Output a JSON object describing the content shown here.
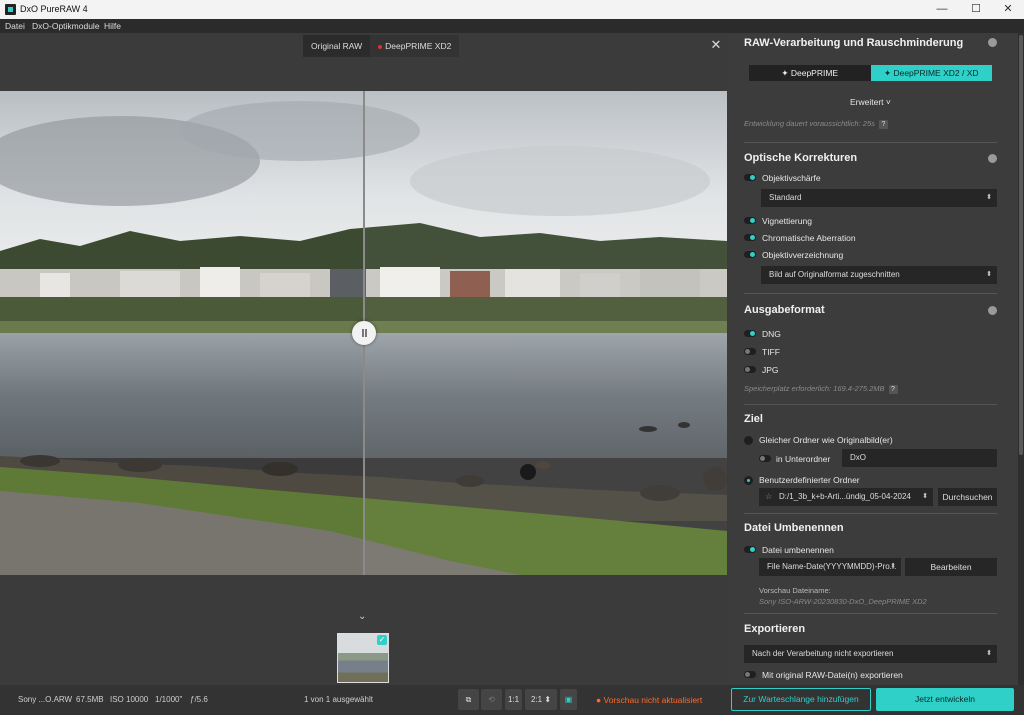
{
  "window": {
    "title": "DxO PureRAW 4",
    "minimize": "—",
    "maximize": "☐",
    "close": "✕"
  },
  "menu": [
    "Datei",
    "DxO-Optikmodule",
    "Hilfe"
  ],
  "compare": {
    "original": "Original RAW",
    "processed": "DeepPRIME XD2",
    "close": "✕"
  },
  "statusbar": {
    "camera": "Sony ...O.ARW",
    "size": "67.5MB",
    "iso": "ISO 10000",
    "shutter": "1/1000\"",
    "aperture": "ƒ/5.6",
    "selection": "1 von 1 ausgewählt",
    "zoom_fit": "1:1",
    "zoom": "2:1",
    "warning": "● Vorschau nicht aktualisiert",
    "queue": "Zur Warteschlange hinzufügen",
    "develop": "Jetzt entwickeln"
  },
  "raw": {
    "title": "RAW-Verarbeitung und Rauschminderung",
    "mode_a": "✦ DeepPRIME",
    "mode_b": "✦ DeepPRIME XD2 / XD",
    "advanced": "Erweitert ˅",
    "duration": "Entwicklung dauert voraussichtlich: 25s",
    "help": "?"
  },
  "optics": {
    "title": "Optische Korrekturen",
    "sharpness": "Objektivschärfe",
    "sharpness_value": "Standard",
    "vignetting": "Vignettierung",
    "chromatic": "Chromatische Aberration",
    "distortion": "Objektivverzeichnung",
    "distortion_value": "Bild auf Originalformat zugeschnitten"
  },
  "output": {
    "title": "Ausgabeformat",
    "dng": "DNG",
    "tiff": "TIFF",
    "jpg": "JPG",
    "storage": "Speicherplatz erforderlich: 169.4-275.2MB",
    "help": "?"
  },
  "target": {
    "title": "Ziel",
    "same_folder": "Gleicher Ordner wie Originalbild(er)",
    "subfolder": "in Unterordner",
    "subfolder_value": "DxO",
    "custom_folder": "Benutzerdefinierter Ordner",
    "path": "D:/1_3b_k+b-Arti...ündig_05-04-2024",
    "browse": "Durchsuchen"
  },
  "rename": {
    "title": "Datei Umbenennen",
    "enable": "Datei umbenennen",
    "pattern": "File Name-Date(YYYYMMDD)-Pro...",
    "edit": "Bearbeiten",
    "preview_label": "Vorschau Dateiname:",
    "preview_value": "Sony ISO-ARW-20230830-DxO_DeepPRIME XD2"
  },
  "export": {
    "title": "Exportieren",
    "option": "Nach der Verarbeitung nicht exportieren",
    "with_raw": "Mit original RAW-Datei(n) exportieren"
  },
  "colors": {
    "accent": "#2ed0c8",
    "warning": "#ff6a2a"
  }
}
